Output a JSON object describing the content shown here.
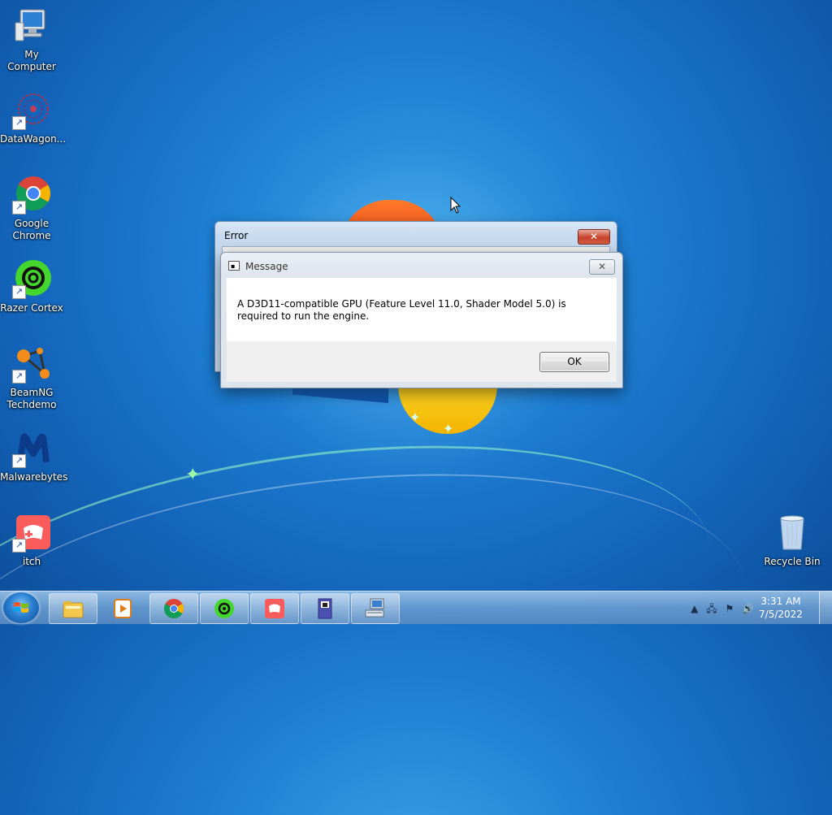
{
  "desktop": {
    "icons": [
      {
        "label": "My Computer",
        "name": "my-computer-icon"
      },
      {
        "label": "DataWagon...",
        "name": "datawagon-icon"
      },
      {
        "label": "Google Chrome",
        "name": "google-chrome-icon"
      },
      {
        "label": "Razer Cortex",
        "name": "razer-cortex-icon"
      },
      {
        "label": "BeamNG Techdemo",
        "name": "beamng-techdemo-icon"
      },
      {
        "label": "Malwarebytes",
        "name": "malwarebytes-icon"
      },
      {
        "label": "itch",
        "name": "itch-icon"
      },
      {
        "label": "Recycle Bin",
        "name": "recycle-bin-icon"
      }
    ]
  },
  "error_window": {
    "title": "Error",
    "close_label": "✕"
  },
  "message_dialog": {
    "title": "Message",
    "close_label": "✕",
    "message": "A D3D11-compatible GPU (Feature Level 11.0, Shader Model 5.0) is required to run the engine.",
    "ok_label": "OK"
  },
  "taskbar": {
    "buttons": [
      "windows-explorer",
      "windows-media-player",
      "google-chrome",
      "razer-cortex",
      "itch",
      "app-window",
      "network-computer"
    ],
    "tray_icons": [
      "show-hidden-icons",
      "network-icon",
      "action-center-flag",
      "volume-icon"
    ],
    "time": "3:31 AM",
    "date": "7/5/2022"
  },
  "colors": {
    "desktop_blue": "#1e7fd4",
    "close_red": "#c7412b"
  }
}
